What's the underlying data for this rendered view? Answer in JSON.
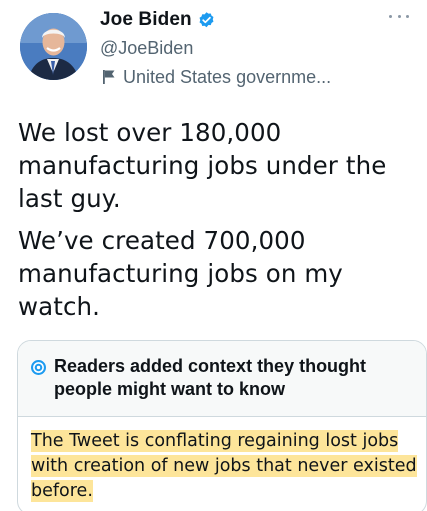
{
  "author": {
    "display_name": "Joe Biden",
    "handle": "@JoeBiden",
    "affiliation": "United States governme..."
  },
  "icons": {
    "verified": "verified-badge-icon",
    "affiliation": "flag-icon",
    "more": "more-options-icon",
    "note": "community-notes-icon"
  },
  "colors": {
    "verified_blue": "#1d9bf0",
    "secondary_text": "#536471",
    "highlight": "#fde59a",
    "note_border": "#cfd9de"
  },
  "tweet": {
    "paragraph_1": "We lost over 180,000 manufacturing jobs under the last guy.",
    "paragraph_2": "We’ve created 700,000 manufacturing jobs on my watch."
  },
  "community_note": {
    "title": "Readers added context they thought people might want to know",
    "body": "The Tweet is conflating regaining lost jobs with creation of new jobs that never existed before."
  }
}
